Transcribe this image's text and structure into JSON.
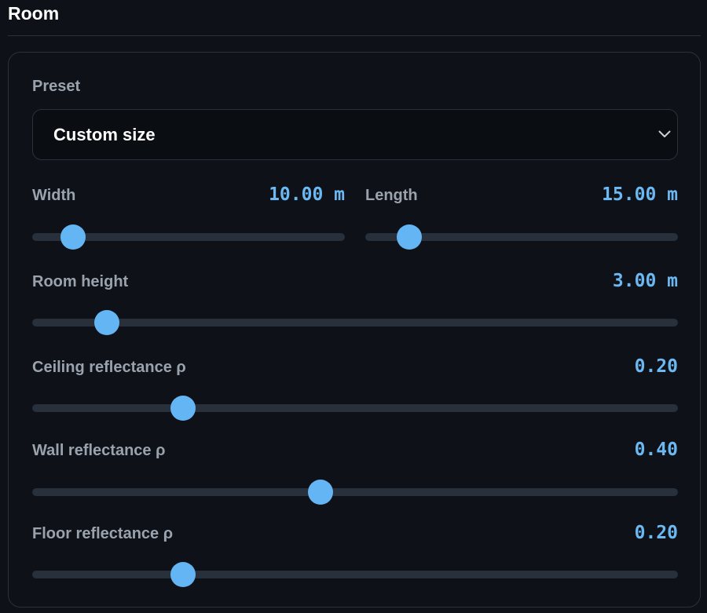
{
  "section": {
    "title": "Room"
  },
  "preset": {
    "label": "Preset",
    "selected": "Custom size"
  },
  "sliders": {
    "width": {
      "label": "Width",
      "value": "10.00 m",
      "fraction": 0.13
    },
    "length": {
      "label": "Length",
      "value": "15.00 m",
      "fraction": 0.14
    },
    "height": {
      "label": "Room height",
      "value": "3.00 m",
      "fraction": 0.115
    },
    "ceiling": {
      "label": "Ceiling reflectance ρ",
      "value": "0.20",
      "fraction": 0.233
    },
    "wall": {
      "label": "Wall reflectance ρ",
      "value": "0.40",
      "fraction": 0.446
    },
    "floor": {
      "label": "Floor reflectance ρ",
      "value": "0.20",
      "fraction": 0.233
    }
  },
  "colors": {
    "accent": "#64b5f4",
    "value_text": "#6cb8f2"
  },
  "icons": {
    "select_arrow": "chevron-down-icon"
  }
}
